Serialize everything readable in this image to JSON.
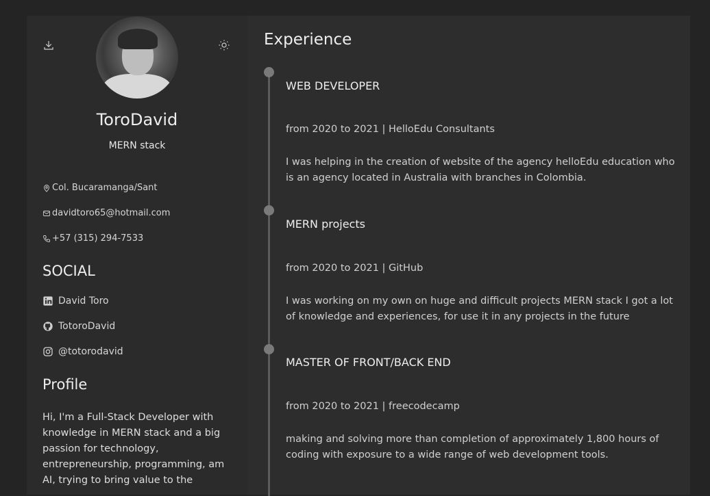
{
  "sidebar": {
    "name": "ToroDavid",
    "role": "MERN stack",
    "location": "Col. Bucaramanga/Sant",
    "email": "davidtoro65@hotmail.com",
    "phone": "+57 (315) 294-7533",
    "social_title": "SOCIAL",
    "social": [
      {
        "label": "David Toro",
        "icon": "linkedin-icon"
      },
      {
        "label": "TotoroDavid",
        "icon": "github-icon"
      },
      {
        "label": "@totorodavid",
        "icon": "instagram-icon"
      }
    ],
    "profile_title": "Profile",
    "profile_text": "Hi, I'm a Full-Stack Developer with knowledge in MERN stack and a big passion for technology, entrepreneurship, programming, am AI, trying to bring value to the"
  },
  "main": {
    "title": "Experience",
    "jobs": [
      {
        "title": "WEB DEVELOPER",
        "meta": "from 2020 to 2021 | HelloEdu Consultants",
        "desc": "I was helping in the creation of website of the agency helloEdu education who is an agency located in Australia with branches in Colombia."
      },
      {
        "title": "MERN projects",
        "meta": "from 2020 to 2021 | GitHub",
        "desc": "I was working on my own on huge and difficult projects MERN stack I got a lot of knowledge and experiences, for use it in any projects in the future"
      },
      {
        "title": "MASTER OF FRONT/BACK END",
        "meta": "from 2020 to 2021 | freecodecamp",
        "desc": "making and solving more than completion of approximately 1,800 hours of coding with exposure to a wide range of web development tools."
      }
    ]
  },
  "icons": {
    "download": "download-icon",
    "theme": "sun-icon",
    "location": "map-pin-icon",
    "email": "mail-icon",
    "phone": "phone-icon"
  }
}
